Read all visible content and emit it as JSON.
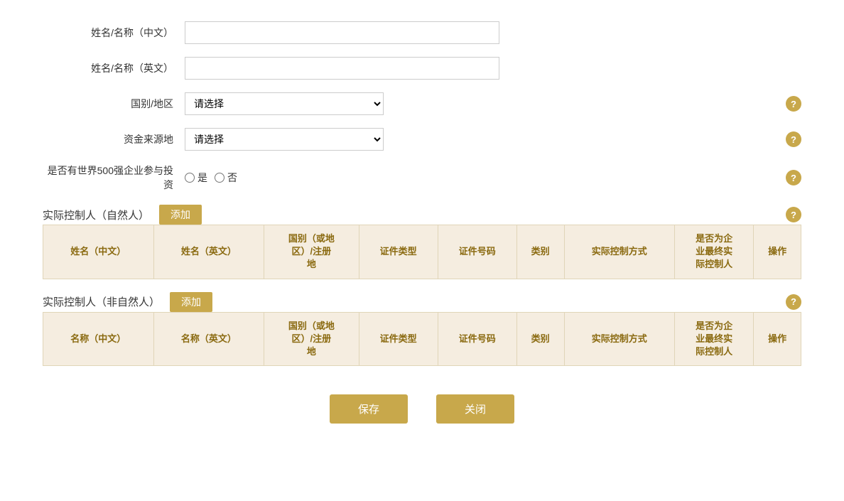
{
  "form": {
    "name_cn_label": "姓名/名称（中文）",
    "name_cn_value": "",
    "name_en_label": "姓名/名称（英文）",
    "name_en_value": "",
    "country_label": "国别/地区",
    "country_placeholder": "请选择",
    "fund_source_label": "资金来源地",
    "fund_source_placeholder": "请选择",
    "fortune500_label": "是否有世界500强企业参与投资",
    "fortune500_yes": "是",
    "fortune500_no": "否"
  },
  "section1": {
    "title": "实际控制人（自然人）",
    "add_label": "添加",
    "columns": [
      "姓名（中文）",
      "姓名（英文）",
      "国别（或地区）/注册地",
      "证件类型",
      "证件号码",
      "类别",
      "实际控制方式",
      "是否为企业最终实际控制人",
      "操作"
    ]
  },
  "section2": {
    "title": "实际控制人（非自然人）",
    "add_label": "添加",
    "columns": [
      "名称（中文）",
      "名称（英文）",
      "国别（或地区）/注册地",
      "证件类型",
      "证件号码",
      "类别",
      "实际控制方式",
      "是否为企业最终实际控制人",
      "操作"
    ]
  },
  "buttons": {
    "save": "保存",
    "close": "关闭"
  },
  "help_icon": "?",
  "icons": {
    "help": "?"
  }
}
